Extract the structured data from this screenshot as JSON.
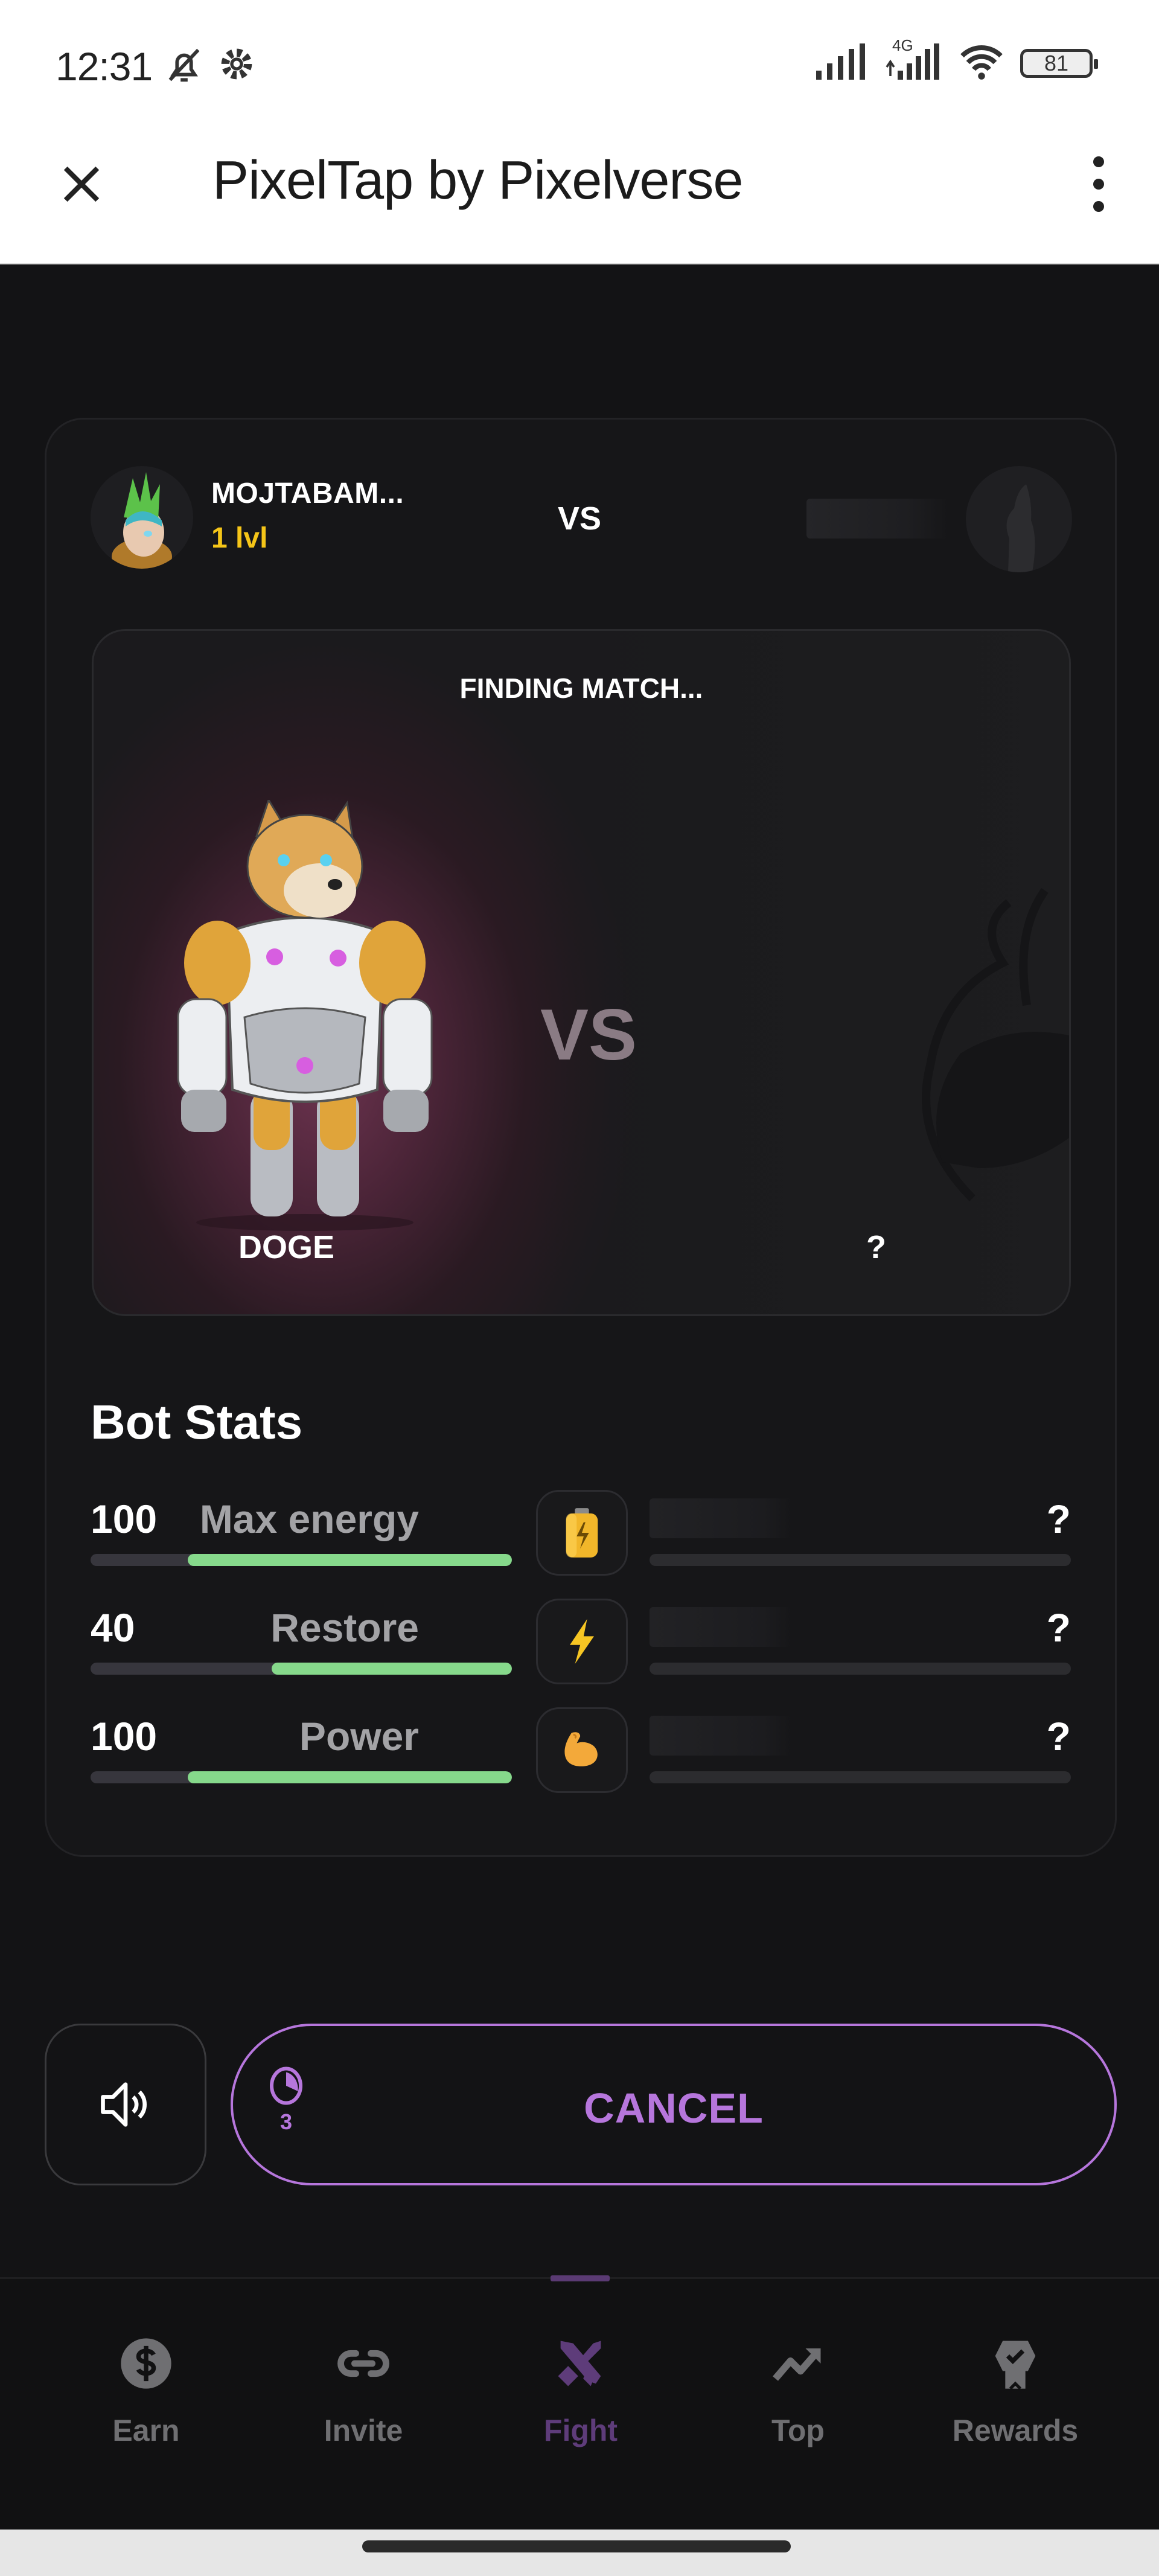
{
  "status_bar": {
    "time": "12:31",
    "icons": [
      "bell-off-icon",
      "gear-icon",
      "signal-icon",
      "signal-4g-icon",
      "wifi-icon"
    ],
    "network_label": "4G",
    "battery": "81"
  },
  "app_bar": {
    "title": "PixelTap by Pixelverse",
    "close_icon": "close-icon",
    "menu_icon": "more-vert-icon"
  },
  "match": {
    "player": {
      "name": "MOJTABAM...",
      "level": "1 lvl"
    },
    "vs_label": "VS",
    "status": "FINDING MATCH...",
    "arena_vs": "VS",
    "player_bot": "DOGE",
    "opponent_bot": "?"
  },
  "bot_stats": {
    "title": "Bot Stats",
    "rows": [
      {
        "value": "100",
        "label": "Max energy",
        "icon": "battery-icon",
        "fill_percent": 77,
        "opponent_value": "?"
      },
      {
        "value": "40",
        "label": "Restore",
        "icon": "lightning-icon",
        "fill_percent": 57,
        "opponent_value": "?"
      },
      {
        "value": "100",
        "label": "Power",
        "icon": "flexed-biceps-icon",
        "fill_percent": 77,
        "opponent_value": "?"
      }
    ],
    "colors": {
      "fill": "#86d98b",
      "track": "#37363d"
    }
  },
  "actions": {
    "sound_icon": "speaker-icon",
    "cancel_label": "CANCEL",
    "timer_value": "3",
    "accent_color": "#b676dc"
  },
  "bottom_nav": {
    "active": "Fight",
    "items": [
      {
        "label": "Earn",
        "icon": "dollar-coin-icon"
      },
      {
        "label": "Invite",
        "icon": "link-icon"
      },
      {
        "label": "Fight",
        "icon": "crossed-swords-icon"
      },
      {
        "label": "Top",
        "icon": "trending-up-icon"
      },
      {
        "label": "Rewards",
        "icon": "award-badge-icon"
      }
    ]
  }
}
